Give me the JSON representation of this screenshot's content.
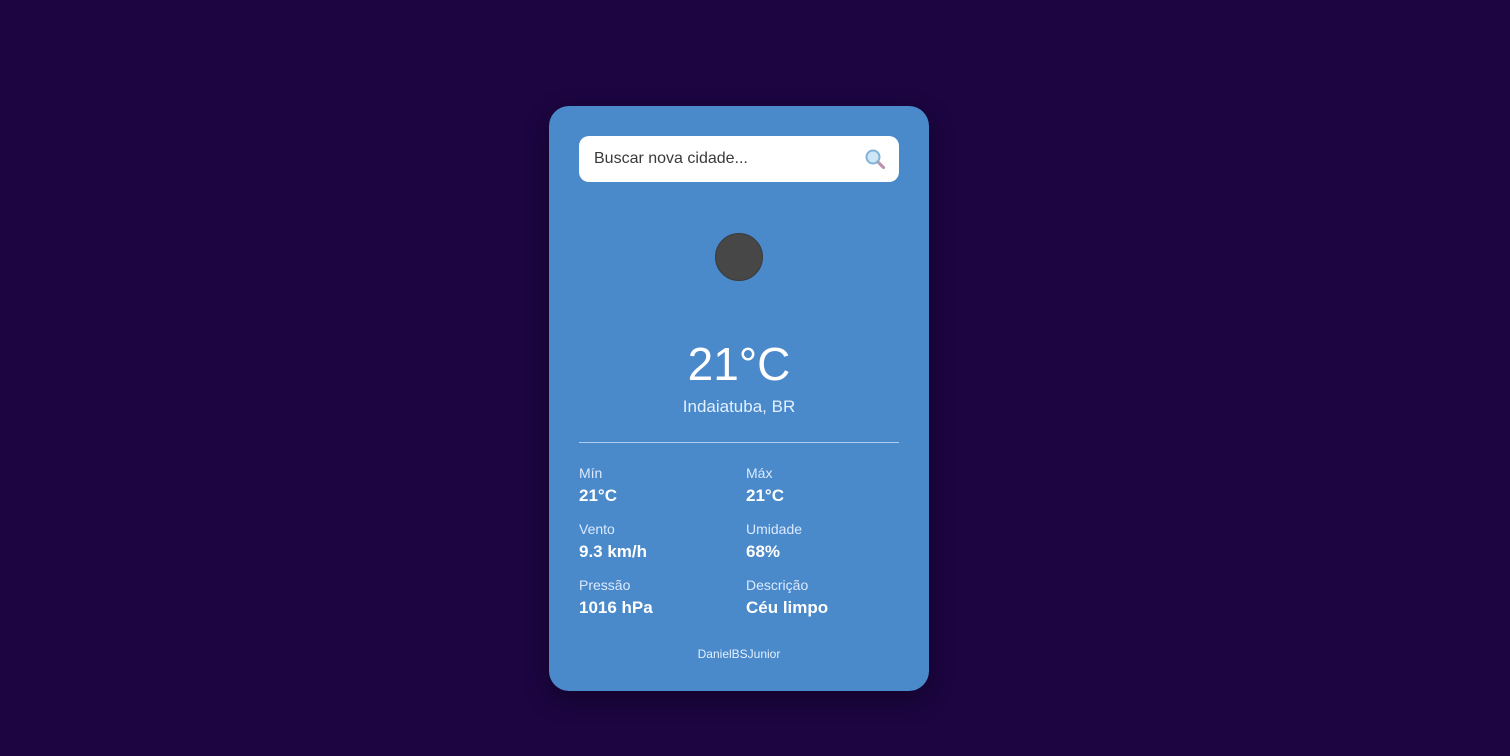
{
  "search": {
    "placeholder": "Buscar nova cidade...",
    "value": ""
  },
  "weather": {
    "icon": "weather-icon",
    "temperature": "21°C",
    "location": "Indaiatuba, BR"
  },
  "stats": {
    "min": {
      "label": "Mín",
      "value": "21°C"
    },
    "max": {
      "label": "Máx",
      "value": "21°C"
    },
    "wind": {
      "label": "Vento",
      "value": "9.3 km/h"
    },
    "humidity": {
      "label": "Umidade",
      "value": "68%"
    },
    "pressure": {
      "label": "Pressão",
      "value": "1016 hPa"
    },
    "description": {
      "label": "Descrição",
      "value": "Céu limpo"
    }
  },
  "footer": {
    "credit": "DanielBSJunior"
  },
  "colors": {
    "background": "#1c0541",
    "card": "#4a89ca",
    "icon_placeholder": "#474747"
  }
}
